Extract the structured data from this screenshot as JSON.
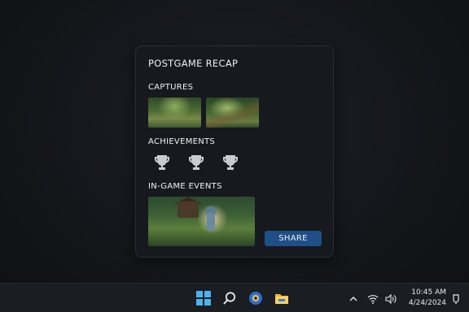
{
  "recap": {
    "title": "POSTGAME RECAP",
    "captures_label": "CAPTURES",
    "achievements_label": "ACHIEVEMENTS",
    "events_label": "IN-GAME EVENTS",
    "share_label": "SHARE",
    "captures": [
      "capture-thumbnail",
      "capture-thumbnail"
    ],
    "achievements": [
      "trophy-icon",
      "trophy-icon",
      "trophy-icon"
    ]
  },
  "taskbar": {
    "icons": [
      "windows-start-icon",
      "search-icon",
      "app-icon",
      "file-explorer-icon"
    ],
    "tray": [
      "chevron-up-icon",
      "wifi-icon",
      "volume-icon",
      "notification-icon"
    ],
    "time": "10:45 AM",
    "date": "4/24/2024"
  },
  "colors": {
    "accent": "#1f4f86",
    "panel_bg": "#16191d",
    "taskbar_bg": "#1a1d22",
    "windows_blue": "#4cb2f2",
    "trophy": "#c8cbd0"
  }
}
